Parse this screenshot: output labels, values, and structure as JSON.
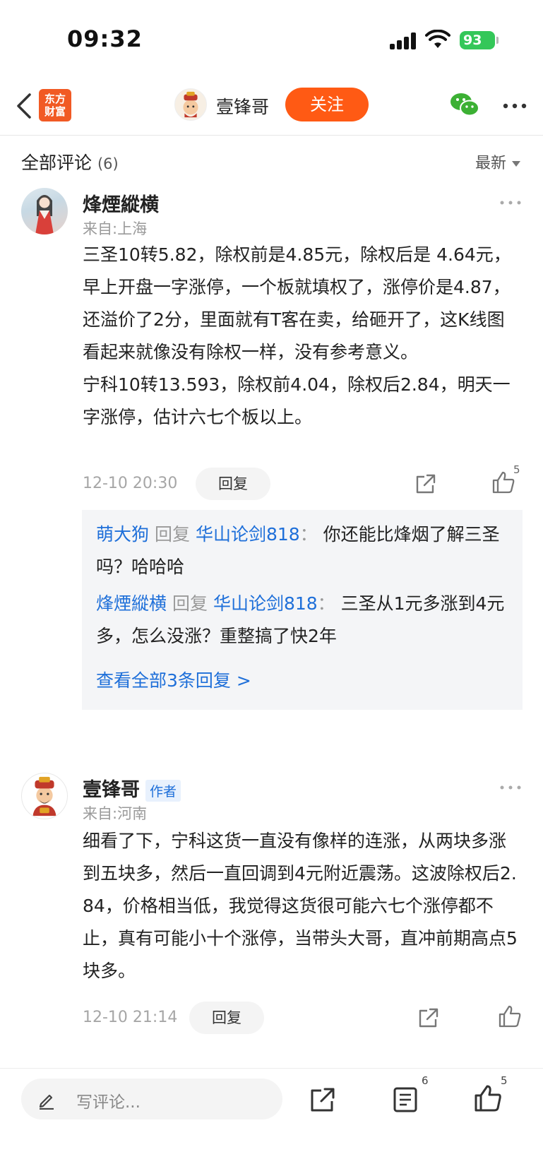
{
  "status_bar": {
    "time": "09:32",
    "battery": "93"
  },
  "nav": {
    "app_logo_line1": "东方",
    "app_logo_line2": "财富",
    "author_name": "壹锋哥",
    "follow_label": "关注"
  },
  "comments_header": {
    "title": "全部评论",
    "count": "(6)",
    "sort": "最新"
  },
  "comments": [
    {
      "username": "烽煙縱横",
      "location": "来自:上海",
      "text": "三圣10转5.82，除权前是4.85元，除权后是 4.64元，早上开盘一字涨停，一个板就填权了，涨停价是4.87，还溢价了2分，里面就有T客在卖，给砸开了，这K线图看起来就像没有除权一样，没有参考意义。\n宁科10转13.593，除权前4.04，除权后2.84，明天一字涨停，估计六七个板以上。",
      "time": "12-10 20:30",
      "reply_label": "回复",
      "like_count": "5",
      "replies": [
        {
          "from": "萌大狗",
          "word": "回复",
          "to": "华山论剑818",
          "sep": "：",
          "text": "你还能比烽烟了解三圣吗？哈哈哈"
        },
        {
          "from": "烽煙縱横",
          "word": "回复",
          "to": "华山论剑818",
          "sep": "：",
          "text": "三圣从1元多涨到4元多，怎么没涨？重整搞了快2年"
        }
      ],
      "view_all": "查看全部3条回复 >"
    },
    {
      "username": "壹锋哥",
      "badge": "作者",
      "location": "来自:河南",
      "text": "细看了下，宁科这货一直没有像样的连涨，从两块多涨到五块多，然后一直回调到4元附近震荡。这波除权后2.84，价格相当低，我觉得这货很可能六七个涨停都不止，真有可能小十个涨停，当带头大哥，直冲前期高点5块多。",
      "time": "12-10 21:14",
      "reply_label": "回复"
    }
  ],
  "bottom_bar": {
    "placeholder": "写评论...",
    "comment_count": "6",
    "like_count": "5"
  }
}
